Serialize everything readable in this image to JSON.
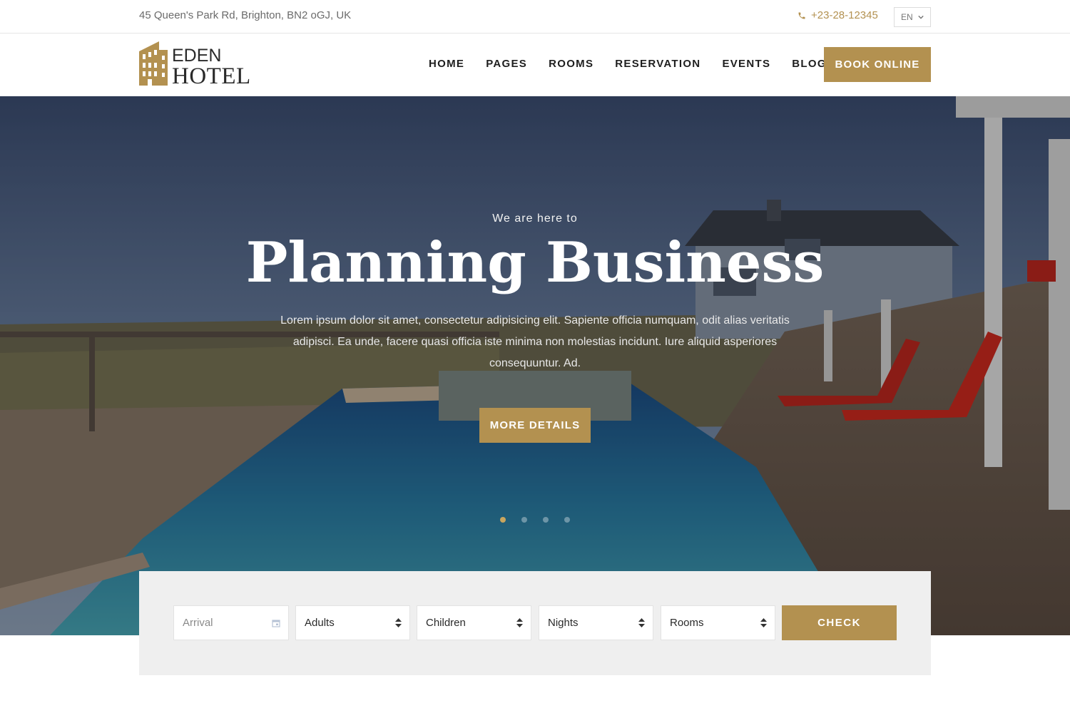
{
  "topbar": {
    "address": "45 Queen's Park Rd, Brighton, BN2 oGJ, UK",
    "phone": "+23-28-12345",
    "language": "EN"
  },
  "header": {
    "logo_line1": "EDEN",
    "logo_line2": "HOTEL",
    "nav": [
      "HOME",
      "PAGES",
      "ROOMS",
      "RESERVATION",
      "EVENTS",
      "BLOG"
    ],
    "book_label": "BOOK ONLINE"
  },
  "hero": {
    "pretitle": "We are here to",
    "title": "Planning Business",
    "body": "Lorem ipsum dolor sit amet, consectetur adipisicing elit. Sapiente officia numquam, odit alias veritatis adipisci. Ea unde, facere quasi officia iste minima non molestias incidunt. Iure aliquid asperiores consequuntur. Ad.",
    "button_label": "MORE DETAILS",
    "slide_count": 4,
    "active_slide": 1
  },
  "booking": {
    "arrival_placeholder": "Arrival",
    "adults": "Adults",
    "children": "Children",
    "nights": "Nights",
    "rooms": "Rooms",
    "check_label": "CHECK"
  },
  "colors": {
    "accent": "#b39150",
    "booking_bg": "#efefef"
  }
}
